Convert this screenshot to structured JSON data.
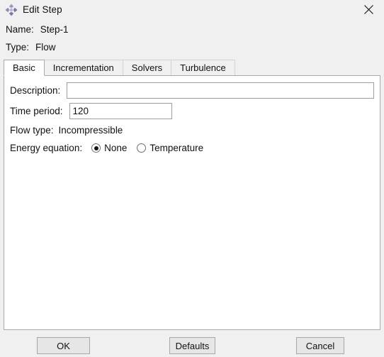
{
  "window": {
    "title": "Edit Step",
    "icon": "step-diamond-icon",
    "icon_color": "#8a86c0",
    "close_icon": "close-icon",
    "background": "#f0f0f0"
  },
  "header": {
    "name_label": "Name:",
    "name_value": "Step-1",
    "type_label": "Type:",
    "type_value": "Flow"
  },
  "tabs": [
    {
      "label": "Basic",
      "selected": true
    },
    {
      "label": "Incrementation",
      "selected": false
    },
    {
      "label": "Solvers",
      "selected": false
    },
    {
      "label": "Turbulence",
      "selected": false
    }
  ],
  "basic_panel": {
    "description": {
      "label": "Description:",
      "value": "",
      "placeholder": ""
    },
    "time_period": {
      "label": "Time period:",
      "value": "120",
      "placeholder": ""
    },
    "flow_type": {
      "label": "Flow type:",
      "value": "Incompressible"
    },
    "energy_equation": {
      "label": "Energy equation:",
      "options": [
        {
          "label": "None",
          "checked": true
        },
        {
          "label": "Temperature",
          "checked": false
        }
      ]
    }
  },
  "footer": {
    "ok_label": "OK",
    "defaults_label": "Defaults",
    "cancel_label": "Cancel"
  }
}
